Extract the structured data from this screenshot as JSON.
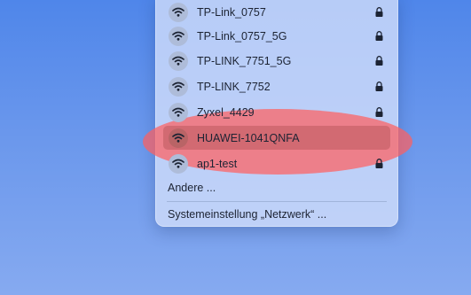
{
  "colors": {
    "desktop_top": "#4f86ea",
    "desktop_bottom": "#86aaf0",
    "highlight": "#ff5f5f",
    "badge": "#aebcd9",
    "badge_selected": "#b96466"
  },
  "wifi_menu": {
    "networks": [
      {
        "name": "TP-Link_0757",
        "secured": true,
        "selected": false,
        "icon": "wifi-icon"
      },
      {
        "name": "TP-Link_0757_5G",
        "secured": true,
        "selected": false,
        "icon": "wifi-icon"
      },
      {
        "name": "TP-LINK_7751_5G",
        "secured": true,
        "selected": false,
        "icon": "wifi-icon"
      },
      {
        "name": "TP-LINK_7752",
        "secured": true,
        "selected": false,
        "icon": "wifi-icon"
      },
      {
        "name": "Zyxel_4429",
        "secured": true,
        "selected": false,
        "icon": "wifi-icon"
      },
      {
        "name": "HUAWEI-1041QNFA",
        "secured": false,
        "selected": true,
        "icon": "wifi-icon"
      },
      {
        "name": "ap1-test",
        "secured": true,
        "selected": false,
        "icon": "wifi-icon"
      }
    ],
    "other_label": "Andere ...",
    "settings_label": "Systemeinstellung „Netzwerk“ ..."
  }
}
